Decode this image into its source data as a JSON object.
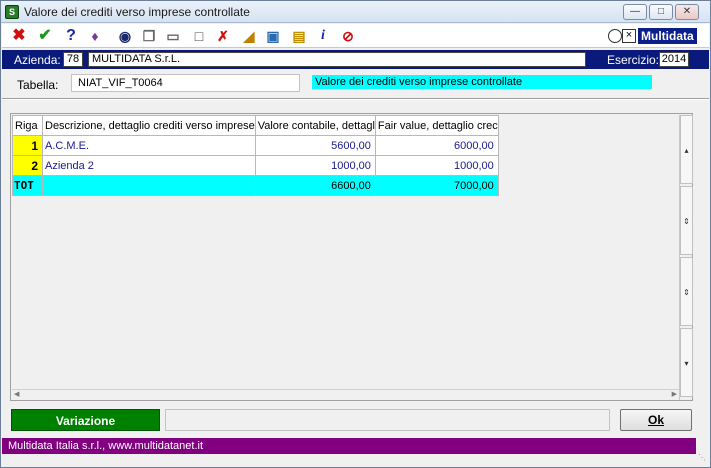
{
  "window": {
    "title": "Valore dei crediti verso imprese controllate"
  },
  "toolbar": {
    "icons": [
      "close-x-icon",
      "confirm-check-icon",
      "help-icon",
      "book-icon",
      "binoculars-icon",
      "copy-icon",
      "paste-icon",
      "new-document-icon",
      "delete-row-icon",
      "ruler-icon",
      "window-icon",
      "folder-icon",
      "info-icon",
      "no-edit-icon"
    ],
    "brand_text": "Multidata"
  },
  "azienda": {
    "label": "Azienda:",
    "code": "78",
    "name": "MULTIDATA S.r.L.",
    "esercizio_label": "Esercizio:",
    "esercizio_value": "2014"
  },
  "tabella": {
    "label": "Tabella:",
    "code": "NIAT_VIF_T0064",
    "description": "Valore dei crediti verso imprese controllate"
  },
  "grid": {
    "headers": [
      "Riga",
      "Descrizione, dettaglio crediti verso imprese",
      "Valore contabile, dettagl",
      "Fair value, dettaglio crec"
    ],
    "rows": [
      {
        "riga": "1",
        "descrizione": "A.C.M.E.",
        "valore": "5600,00",
        "fair": "6000,00"
      },
      {
        "riga": "2",
        "descrizione": "Azienda 2",
        "valore": "1000,00",
        "fair": "1000,00"
      }
    ],
    "total": {
      "label": "TOT",
      "valore": "6600,00",
      "fair": "7000,00"
    }
  },
  "buttons": {
    "variazione": "Variazione",
    "ok": "Ok"
  },
  "footer": {
    "text": "Multidata Italia s.r.l., www.multidatanet.it"
  },
  "colors": {
    "header_bar": "#0a1a7a",
    "cyan": "#00ffff",
    "riga_yellow": "#ffff00",
    "variazione_green": "#008000",
    "footer_purple": "#800080"
  }
}
